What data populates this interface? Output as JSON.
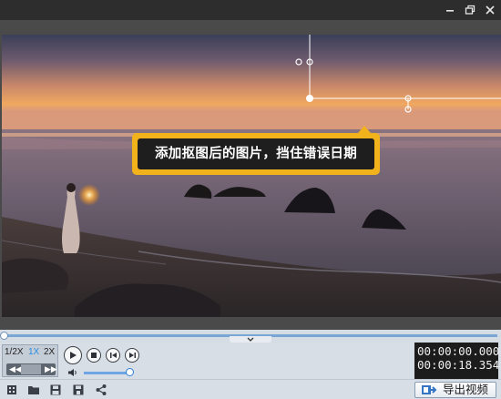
{
  "window": {
    "minimize_icon": "minimize-icon",
    "restore_icon": "restore-icon",
    "close_icon": "close-icon"
  },
  "viewer": {
    "callout_text": "添加抠图后的图片，挡住错误日期",
    "callout_color": "#f2b21c",
    "callout_bg": "#1e1e1e"
  },
  "playback": {
    "speeds": [
      "1/2X",
      "1X",
      "2X"
    ],
    "active_speed": "1X",
    "current_time": "00:00:00.000",
    "total_time": "00:00:18.354",
    "progress": 0.0,
    "volume": 1.0
  },
  "toolbar": {
    "export_label": "导出视频"
  }
}
